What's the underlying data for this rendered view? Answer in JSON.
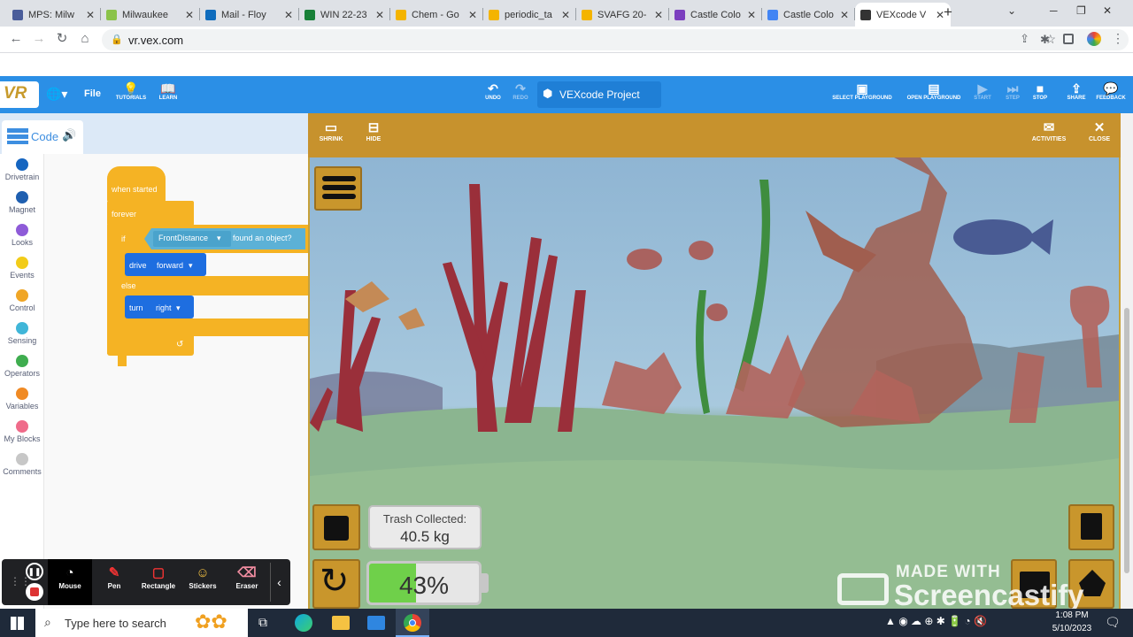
{
  "browser": {
    "tabs": [
      {
        "title": "MPS: Milw",
        "fav_color": "#4a5d9a"
      },
      {
        "title": "Milwaukee",
        "fav_color": "#8bc34a"
      },
      {
        "title": "Mail - Floy",
        "fav_color": "#0f6cbd"
      },
      {
        "title": "WIN 22-23",
        "fav_color": "#188038"
      },
      {
        "title": "Chem - Go",
        "fav_color": "#f4b400"
      },
      {
        "title": "periodic_ta",
        "fav_color": "#f4b400"
      },
      {
        "title": "SVAFG 20-",
        "fav_color": "#f4b400"
      },
      {
        "title": "Castle Colo",
        "fav_color": "#7b3fbf"
      },
      {
        "title": "Castle Colo",
        "fav_color": "#4285f4"
      },
      {
        "title": "VEXcode V",
        "fav_color": "#333333"
      }
    ],
    "new_tab": "+",
    "url": "vr.vex.com"
  },
  "vex": {
    "logo": "VR",
    "file": "File",
    "tutorials": "TUTORIALS",
    "learn": "LEARN",
    "undo": "UNDO",
    "redo": "REDO",
    "project_title": "VEXcode Project",
    "select_playground": "SELECT PLAYGROUND",
    "open_playground": "OPEN PLAYGROUND",
    "start": "START",
    "step": "STEP",
    "stop": "STOP",
    "share": "SHARE",
    "feedback": "FEEDBACK",
    "accent": "#2b8fe6"
  },
  "code_panel": {
    "tab_label": "Code",
    "categories": [
      {
        "label": "Drivetrain",
        "color": "#1565c0"
      },
      {
        "label": "Magnet",
        "color": "#1f5fb0"
      },
      {
        "label": "Looks",
        "color": "#8e5bd8"
      },
      {
        "label": "Events",
        "color": "#f2cc19"
      },
      {
        "label": "Control",
        "color": "#f0a626"
      },
      {
        "label": "Sensing",
        "color": "#40b6d8"
      },
      {
        "label": "Operators",
        "color": "#3fad4f"
      },
      {
        "label": "Variables",
        "color": "#f08a24"
      },
      {
        "label": "My Blocks",
        "color": "#ef6b8a"
      },
      {
        "label": "Comments",
        "color": "#c7c7c7"
      }
    ],
    "blocks": {
      "when_started": "when started",
      "forever": "forever",
      "if": "if",
      "sensor": "FrontDistance",
      "found": "found an object?",
      "drive": "drive",
      "drive_dir": "forward",
      "else": "else",
      "turn": "turn",
      "turn_dir": "right"
    }
  },
  "playground": {
    "shrink": "SHRINK",
    "hide": "HIDE",
    "activities": "ACTIVITIES",
    "close": "CLOSE",
    "trash_label": "Trash Collected:",
    "trash_value": "40.5 kg",
    "battery_percent": 43,
    "battery_text": "43%"
  },
  "recorder": {
    "tools": [
      "Mouse",
      "Pen",
      "Rectangle",
      "Stickers",
      "Eraser"
    ]
  },
  "watermark": {
    "made_with": "MADE WITH",
    "brand": "Screencastify"
  },
  "taskbar": {
    "search_placeholder": "Type here to search",
    "time": "1:08 PM",
    "date": "5/10/2023"
  }
}
